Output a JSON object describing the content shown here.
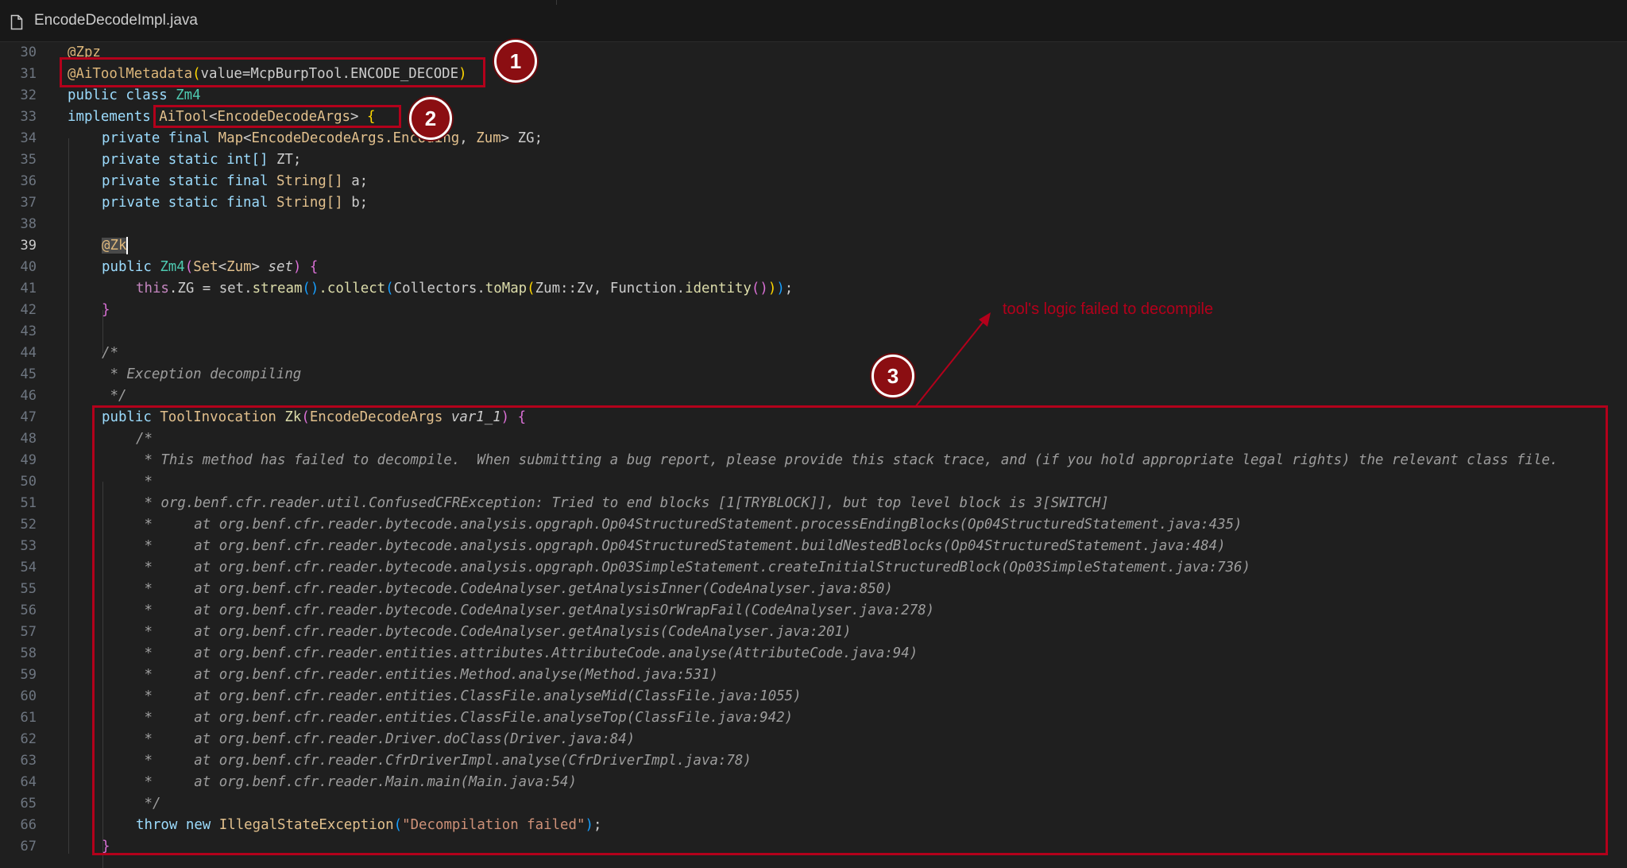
{
  "tab": {
    "filename": "EncodeDecodeImpl.java",
    "icon": "file-icon"
  },
  "gutter": [
    "30",
    "31",
    "32",
    "33",
    "34",
    "35",
    "36",
    "37",
    "38",
    "39",
    "40",
    "41",
    "42",
    "43",
    "44",
    "45",
    "46",
    "47",
    "48",
    "49",
    "50",
    "51",
    "52",
    "53",
    "54",
    "55",
    "56",
    "57",
    "58",
    "59",
    "60",
    "61",
    "62",
    "63",
    "64",
    "65",
    "66",
    "67"
  ],
  "active_line": "39",
  "stack_lines": [
    "     at org.benf.cfr.reader.bytecode.analysis.opgraph.Op04StructuredStatement.processEndingBlocks(Op04StructuredStatement.java:435)",
    "     at org.benf.cfr.reader.bytecode.analysis.opgraph.Op04StructuredStatement.buildNestedBlocks(Op04StructuredStatement.java:484)",
    "     at org.benf.cfr.reader.bytecode.analysis.opgraph.Op03SimpleStatement.createInitialStructuredBlock(Op03SimpleStatement.java:736)",
    "     at org.benf.cfr.reader.bytecode.CodeAnalyser.getAnalysisInner(CodeAnalyser.java:850)",
    "     at org.benf.cfr.reader.bytecode.CodeAnalyser.getAnalysisOrWrapFail(CodeAnalyser.java:278)",
    "     at org.benf.cfr.reader.bytecode.CodeAnalyser.getAnalysis(CodeAnalyser.java:201)",
    "     at org.benf.cfr.reader.entities.attributes.AttributeCode.analyse(AttributeCode.java:94)",
    "     at org.benf.cfr.reader.entities.Method.analyse(Method.java:531)",
    "     at org.benf.cfr.reader.entities.ClassFile.analyseMid(ClassFile.java:1055)",
    "     at org.benf.cfr.reader.entities.ClassFile.analyseTop(ClassFile.java:942)",
    "     at org.benf.cfr.reader.Driver.doClass(Driver.java:84)",
    "     at org.benf.cfr.reader.CfrDriverImpl.analyse(CfrDriverImpl.java:78)",
    "     at org.benf.cfr.reader.Main.main(Main.java:54)"
  ],
  "code": {
    "ann_zpz": "@Zpz",
    "ann_meta": "@AiToolMetadata",
    "meta_value": "value=McpBurpTool.ENCODE_DECODE",
    "kw_public": "public",
    "kw_class": "class",
    "class_name": "Zm4",
    "kw_implements": "implements",
    "ai_tool": "AiTool",
    "type_args": "EncodeDecodeArgs",
    "kw_private": "private",
    "kw_final": "final",
    "kw_static": "static",
    "map_type": "Map",
    "encoding_type": "EncodeDecodeArgs.Encoding",
    "zum_type": "Zum",
    "field_zg": "ZG;",
    "int_arr": "int[]",
    "field_zt": "ZT;",
    "string_arr": "String[]",
    "field_a": "a;",
    "field_b": "b;",
    "ann_zk": "@Zk",
    "set_type": "Set",
    "param_set": "set",
    "kw_this": "this",
    "assign_lhs": ".ZG = set.",
    "m_stream": "stream",
    "m_collect": ".collect",
    "collectors": "Collectors.",
    "m_tomap": "toMap",
    "zum_ref": "Zum::Zv, Function.",
    "m_identity": "identity",
    "c_open": "/*",
    "c_exc": " * Exception decompiling",
    "c_close": " */",
    "invocation_type": "ToolInvocation",
    "method_zk": "Zk",
    "param_var": "var1_1",
    "c49": " * This method has failed to decompile.  When submitting a bug report, please provide this stack trace, and (if you hold appropriate legal rights) the relevant class file.",
    "c50": " *",
    "c51": " * org.benf.cfr.reader.util.ConfusedCFRException: Tried to end blocks [1[TRYBLOCK]], but top level block is 3[SWITCH]",
    "c65": " */",
    "kw_throw": "throw",
    "kw_new": "new",
    "exc_type": "IllegalStateException",
    "exc_msg": "\"Decompilation failed\""
  },
  "annotations": {
    "badge_1": "1",
    "badge_2": "2",
    "badge_3": "3",
    "note": "tool's logic failed to decompile",
    "highlight_color": "#b3001b"
  }
}
